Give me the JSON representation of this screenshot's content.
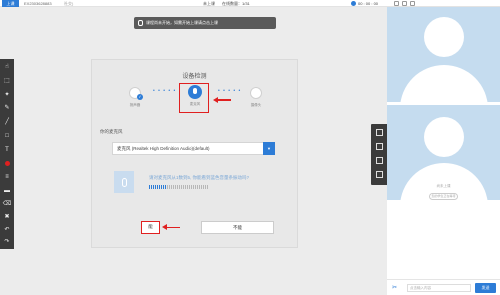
{
  "topbar": {
    "start_label": "上课",
    "course_id": "EX2303628883",
    "course_note": "社交)",
    "status_text": "未上课",
    "online_count": "在线数量：1/31",
    "clock_time": "00 : 00 : 00"
  },
  "notice": {
    "text": "课程尚未开始，如需开始上课请点击上课"
  },
  "dialog": {
    "title": "设备检测",
    "devices": [
      {
        "label": "扬声器",
        "icon": "speaker-icon"
      },
      {
        "label": "麦克风",
        "icon": "microphone-icon"
      },
      {
        "label": "摄像头",
        "icon": "camera-icon"
      }
    ],
    "mic_section_label": "你的麦克风",
    "mic_select_value": "麦克风 (Realtek High Definition Audio)(default)",
    "test_prompt": "请对麦克风从1数到5, 你能看到蓝色音量条振动吗?",
    "level_bars_lit": 9,
    "level_bars_total": 30,
    "yes_label": "能",
    "no_label": "不能"
  },
  "sidebar_tools": [
    "pointer-icon",
    "select-icon",
    "laser-icon",
    "pen-icon",
    "line-icon",
    "rect-icon",
    "text-icon",
    "color-icon",
    "thickness-icon",
    "eraser-icon",
    "clear-icon",
    "undo-icon",
    "redo-icon"
  ],
  "right_panel": {
    "not_live_text": "尚未上课",
    "live_pill_text": "您的学生正在等待",
    "chat_placeholder": "点击输入内容",
    "send_label": "发送"
  },
  "colors": {
    "accent": "#2d7cd6",
    "highlight": "#e02020"
  }
}
